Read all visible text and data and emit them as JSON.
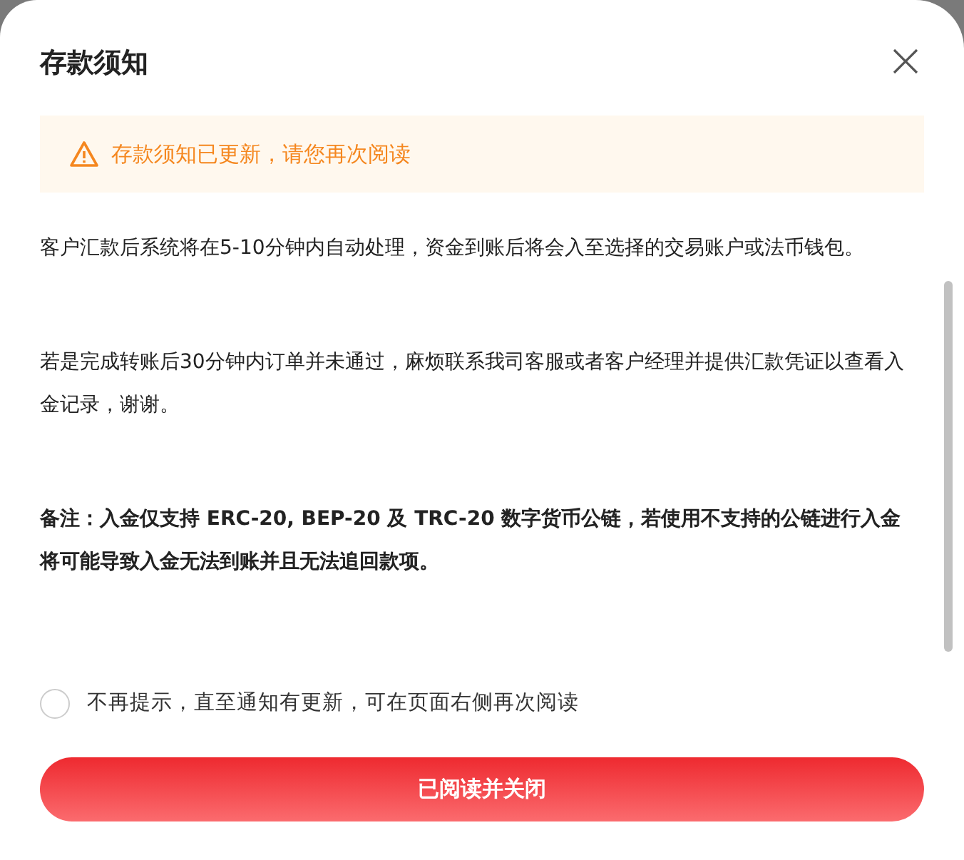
{
  "dialog": {
    "title": "存款须知"
  },
  "alert": {
    "text": "存款须知已更新，请您再次阅读"
  },
  "paragraphs": [
    {
      "kind": "normal",
      "text": "客户汇款后系统将在5-10分钟内自动处理，资金到账后将会入至选择的交易账户或法币钱包。"
    },
    {
      "kind": "normal",
      "text": "若是完成转账后30分钟内订单并未通过，麻烦联系我司客服或者客户经理并提供汇款凭证以查看入金记录，谢谢。"
    },
    {
      "kind": "bold",
      "text": "备注：入金仅支持 ERC-20, BEP-20 及 TRC-20 数字货币公链，若使用不支持的公链进行入金将可能导致入金无法到账并且无法追回款项。"
    }
  ],
  "checkbox": {
    "label": "不再提示，直至通知有更新，可在页面右侧再次阅读",
    "checked": false
  },
  "button": {
    "label": "已阅读并关闭"
  }
}
